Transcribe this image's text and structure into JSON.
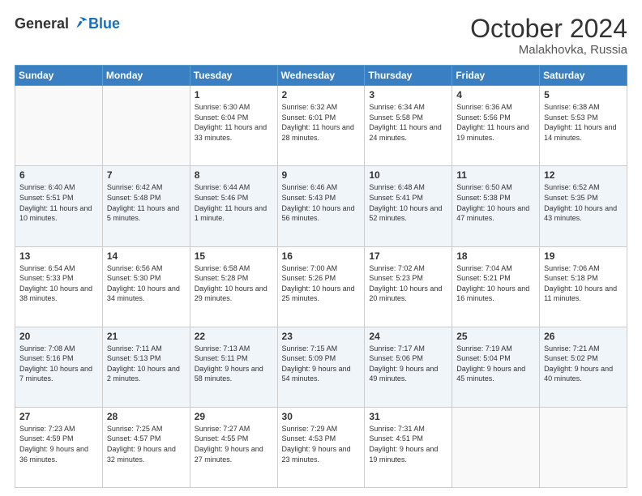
{
  "header": {
    "logo": {
      "general": "General",
      "blue": "Blue"
    },
    "title": "October 2024",
    "location": "Malakhovka, Russia"
  },
  "weekdays": [
    "Sunday",
    "Monday",
    "Tuesday",
    "Wednesday",
    "Thursday",
    "Friday",
    "Saturday"
  ],
  "weeks": [
    [
      {
        "day": "",
        "sunrise": "",
        "sunset": "",
        "daylight": ""
      },
      {
        "day": "",
        "sunrise": "",
        "sunset": "",
        "daylight": ""
      },
      {
        "day": "1",
        "sunrise": "Sunrise: 6:30 AM",
        "sunset": "Sunset: 6:04 PM",
        "daylight": "Daylight: 11 hours and 33 minutes."
      },
      {
        "day": "2",
        "sunrise": "Sunrise: 6:32 AM",
        "sunset": "Sunset: 6:01 PM",
        "daylight": "Daylight: 11 hours and 28 minutes."
      },
      {
        "day": "3",
        "sunrise": "Sunrise: 6:34 AM",
        "sunset": "Sunset: 5:58 PM",
        "daylight": "Daylight: 11 hours and 24 minutes."
      },
      {
        "day": "4",
        "sunrise": "Sunrise: 6:36 AM",
        "sunset": "Sunset: 5:56 PM",
        "daylight": "Daylight: 11 hours and 19 minutes."
      },
      {
        "day": "5",
        "sunrise": "Sunrise: 6:38 AM",
        "sunset": "Sunset: 5:53 PM",
        "daylight": "Daylight: 11 hours and 14 minutes."
      }
    ],
    [
      {
        "day": "6",
        "sunrise": "Sunrise: 6:40 AM",
        "sunset": "Sunset: 5:51 PM",
        "daylight": "Daylight: 11 hours and 10 minutes."
      },
      {
        "day": "7",
        "sunrise": "Sunrise: 6:42 AM",
        "sunset": "Sunset: 5:48 PM",
        "daylight": "Daylight: 11 hours and 5 minutes."
      },
      {
        "day": "8",
        "sunrise": "Sunrise: 6:44 AM",
        "sunset": "Sunset: 5:46 PM",
        "daylight": "Daylight: 11 hours and 1 minute."
      },
      {
        "day": "9",
        "sunrise": "Sunrise: 6:46 AM",
        "sunset": "Sunset: 5:43 PM",
        "daylight": "Daylight: 10 hours and 56 minutes."
      },
      {
        "day": "10",
        "sunrise": "Sunrise: 6:48 AM",
        "sunset": "Sunset: 5:41 PM",
        "daylight": "Daylight: 10 hours and 52 minutes."
      },
      {
        "day": "11",
        "sunrise": "Sunrise: 6:50 AM",
        "sunset": "Sunset: 5:38 PM",
        "daylight": "Daylight: 10 hours and 47 minutes."
      },
      {
        "day": "12",
        "sunrise": "Sunrise: 6:52 AM",
        "sunset": "Sunset: 5:35 PM",
        "daylight": "Daylight: 10 hours and 43 minutes."
      }
    ],
    [
      {
        "day": "13",
        "sunrise": "Sunrise: 6:54 AM",
        "sunset": "Sunset: 5:33 PM",
        "daylight": "Daylight: 10 hours and 38 minutes."
      },
      {
        "day": "14",
        "sunrise": "Sunrise: 6:56 AM",
        "sunset": "Sunset: 5:30 PM",
        "daylight": "Daylight: 10 hours and 34 minutes."
      },
      {
        "day": "15",
        "sunrise": "Sunrise: 6:58 AM",
        "sunset": "Sunset: 5:28 PM",
        "daylight": "Daylight: 10 hours and 29 minutes."
      },
      {
        "day": "16",
        "sunrise": "Sunrise: 7:00 AM",
        "sunset": "Sunset: 5:26 PM",
        "daylight": "Daylight: 10 hours and 25 minutes."
      },
      {
        "day": "17",
        "sunrise": "Sunrise: 7:02 AM",
        "sunset": "Sunset: 5:23 PM",
        "daylight": "Daylight: 10 hours and 20 minutes."
      },
      {
        "day": "18",
        "sunrise": "Sunrise: 7:04 AM",
        "sunset": "Sunset: 5:21 PM",
        "daylight": "Daylight: 10 hours and 16 minutes."
      },
      {
        "day": "19",
        "sunrise": "Sunrise: 7:06 AM",
        "sunset": "Sunset: 5:18 PM",
        "daylight": "Daylight: 10 hours and 11 minutes."
      }
    ],
    [
      {
        "day": "20",
        "sunrise": "Sunrise: 7:08 AM",
        "sunset": "Sunset: 5:16 PM",
        "daylight": "Daylight: 10 hours and 7 minutes."
      },
      {
        "day": "21",
        "sunrise": "Sunrise: 7:11 AM",
        "sunset": "Sunset: 5:13 PM",
        "daylight": "Daylight: 10 hours and 2 minutes."
      },
      {
        "day": "22",
        "sunrise": "Sunrise: 7:13 AM",
        "sunset": "Sunset: 5:11 PM",
        "daylight": "Daylight: 9 hours and 58 minutes."
      },
      {
        "day": "23",
        "sunrise": "Sunrise: 7:15 AM",
        "sunset": "Sunset: 5:09 PM",
        "daylight": "Daylight: 9 hours and 54 minutes."
      },
      {
        "day": "24",
        "sunrise": "Sunrise: 7:17 AM",
        "sunset": "Sunset: 5:06 PM",
        "daylight": "Daylight: 9 hours and 49 minutes."
      },
      {
        "day": "25",
        "sunrise": "Sunrise: 7:19 AM",
        "sunset": "Sunset: 5:04 PM",
        "daylight": "Daylight: 9 hours and 45 minutes."
      },
      {
        "day": "26",
        "sunrise": "Sunrise: 7:21 AM",
        "sunset": "Sunset: 5:02 PM",
        "daylight": "Daylight: 9 hours and 40 minutes."
      }
    ],
    [
      {
        "day": "27",
        "sunrise": "Sunrise: 7:23 AM",
        "sunset": "Sunset: 4:59 PM",
        "daylight": "Daylight: 9 hours and 36 minutes."
      },
      {
        "day": "28",
        "sunrise": "Sunrise: 7:25 AM",
        "sunset": "Sunset: 4:57 PM",
        "daylight": "Daylight: 9 hours and 32 minutes."
      },
      {
        "day": "29",
        "sunrise": "Sunrise: 7:27 AM",
        "sunset": "Sunset: 4:55 PM",
        "daylight": "Daylight: 9 hours and 27 minutes."
      },
      {
        "day": "30",
        "sunrise": "Sunrise: 7:29 AM",
        "sunset": "Sunset: 4:53 PM",
        "daylight": "Daylight: 9 hours and 23 minutes."
      },
      {
        "day": "31",
        "sunrise": "Sunrise: 7:31 AM",
        "sunset": "Sunset: 4:51 PM",
        "daylight": "Daylight: 9 hours and 19 minutes."
      },
      {
        "day": "",
        "sunrise": "",
        "sunset": "",
        "daylight": ""
      },
      {
        "day": "",
        "sunrise": "",
        "sunset": "",
        "daylight": ""
      }
    ]
  ]
}
